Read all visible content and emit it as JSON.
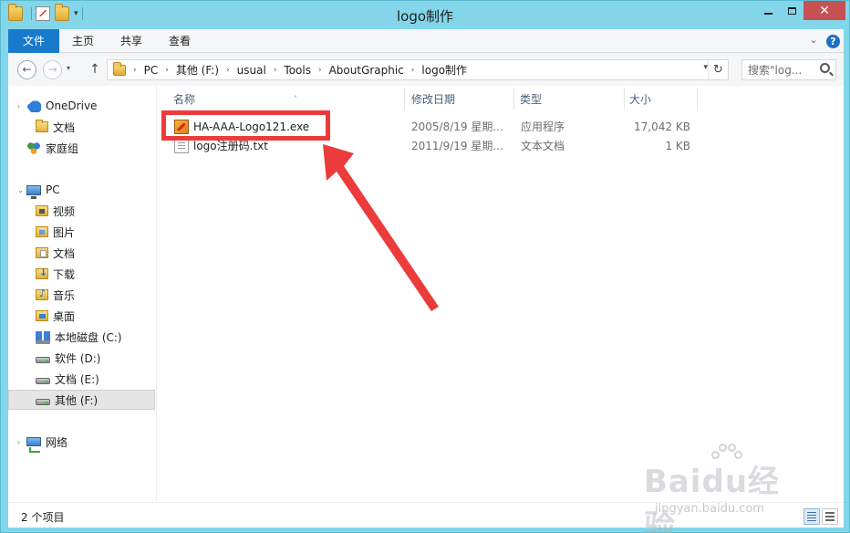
{
  "window": {
    "title": "logo制作"
  },
  "ribbon": {
    "tabs": [
      {
        "label": "文件"
      },
      {
        "label": "主页"
      },
      {
        "label": "共享"
      },
      {
        "label": "查看"
      }
    ]
  },
  "address": {
    "crumbs": [
      "PC",
      "其他 (F:)",
      "usual",
      "Tools",
      "AboutGraphic",
      "logo制作"
    ]
  },
  "search": {
    "placeholder": "搜索\"log..."
  },
  "sidebar": {
    "items": [
      {
        "label": "OneDrive",
        "icon": "onedrive-icon"
      },
      {
        "label": "文档",
        "icon": "folder-icon"
      },
      {
        "label": "家庭组",
        "icon": "homegroup-icon"
      },
      {
        "label": "PC",
        "icon": "pc-icon"
      },
      {
        "label": "视频",
        "icon": "videos-folder-icon"
      },
      {
        "label": "图片",
        "icon": "pictures-folder-icon"
      },
      {
        "label": "文档",
        "icon": "documents-folder-icon"
      },
      {
        "label": "下载",
        "icon": "downloads-folder-icon"
      },
      {
        "label": "音乐",
        "icon": "music-folder-icon"
      },
      {
        "label": "桌面",
        "icon": "desktop-folder-icon"
      },
      {
        "label": "本地磁盘 (C:)",
        "icon": "system-drive-icon"
      },
      {
        "label": "软件 (D:)",
        "icon": "drive-icon"
      },
      {
        "label": "文档 (E:)",
        "icon": "drive-icon"
      },
      {
        "label": "其他 (F:)",
        "icon": "drive-icon"
      },
      {
        "label": "网络",
        "icon": "network-icon"
      }
    ]
  },
  "list": {
    "columns": [
      "名称",
      "修改日期",
      "类型",
      "大小"
    ],
    "rows": [
      {
        "name": "HA-AAA-Logo121.exe",
        "date": "2005/8/19 星期...",
        "type": "应用程序",
        "size": "17,042 KB",
        "icon": "exe-icon"
      },
      {
        "name": "logo注册码.txt",
        "date": "2011/9/19 星期...",
        "type": "文本文档",
        "size": "1 KB",
        "icon": "txt-icon"
      }
    ]
  },
  "status": {
    "count": "2 个项目"
  },
  "watermark": {
    "main": "Baidu经验",
    "url": "jingyan.baidu.com"
  },
  "colors": {
    "frame": "#83d6ea",
    "file_tab": "#1979ca",
    "close_button": "#c75050",
    "annotation": "#ec3b3b"
  }
}
